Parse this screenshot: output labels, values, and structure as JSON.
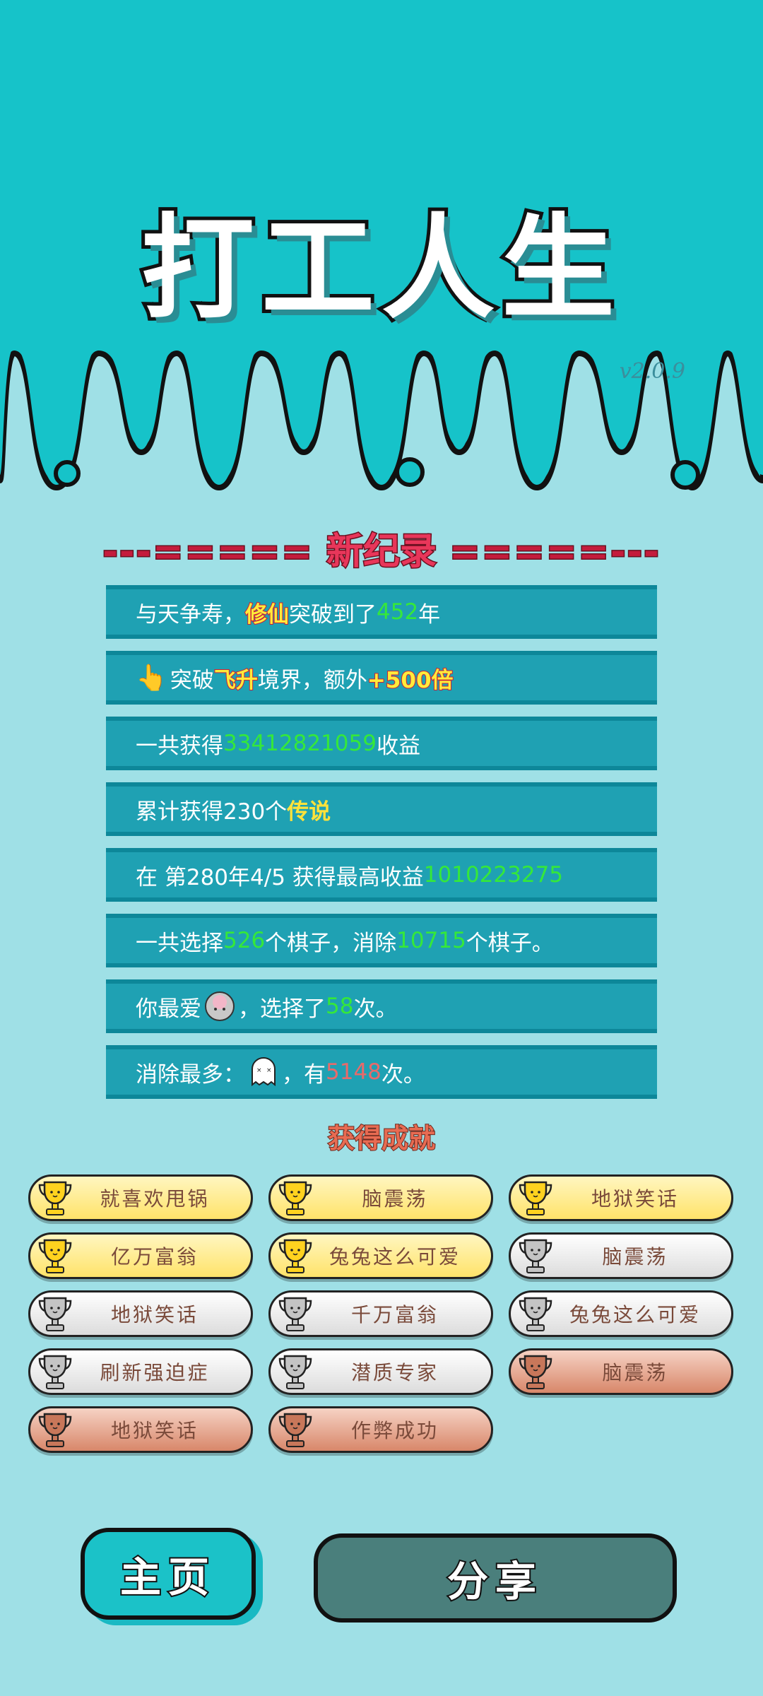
{
  "header": {
    "title": "打工人生",
    "version": "v2.0.9"
  },
  "record_section": {
    "dashes_left": "---=====",
    "title": "新纪录",
    "dashes_right": "=====---"
  },
  "records": [
    {
      "t1": "与天争寿，",
      "hl": "修仙",
      "t2": "突破到了",
      "num": "452",
      "t3": "年"
    },
    {
      "t1": "突破",
      "hl": "飞升",
      "t2": "境界，额外",
      "hl2": "+500倍"
    },
    {
      "t1": "一共获得",
      "num": "33412821059",
      "t2": "收益"
    },
    {
      "t1": "累计获得230个",
      "legend": "传说"
    },
    {
      "t1": "在 第280年4/5 获得最高收益",
      "num": "1010223275"
    },
    {
      "t1": "一共选择",
      "num": "526",
      "t2": "个棋子，消除",
      "num2": "10715",
      "t3": "个棋子。"
    },
    {
      "t1": "你最爱",
      "t2": "，选择了",
      "num": "58",
      "t3": "次。"
    },
    {
      "t1": "消除最多：",
      "t2": "，有",
      "num": "5148",
      "t3": "次。"
    }
  ],
  "achievements_title": "获得成就",
  "achievements": [
    {
      "label": "就喜欢甩锅",
      "tier": "gold"
    },
    {
      "label": "脑震荡",
      "tier": "gold"
    },
    {
      "label": "地狱笑话",
      "tier": "gold"
    },
    {
      "label": "亿万富翁",
      "tier": "gold"
    },
    {
      "label": "兔兔这么可爱",
      "tier": "gold"
    },
    {
      "label": "脑震荡",
      "tier": "silver"
    },
    {
      "label": "地狱笑话",
      "tier": "silver"
    },
    {
      "label": "千万富翁",
      "tier": "silver"
    },
    {
      "label": "兔兔这么可爱",
      "tier": "silver"
    },
    {
      "label": "刷新强迫症",
      "tier": "silver"
    },
    {
      "label": "潜质专家",
      "tier": "silver"
    },
    {
      "label": "脑震荡",
      "tier": "bronze"
    },
    {
      "label": "地狱笑话",
      "tier": "bronze"
    },
    {
      "label": "作弊成功",
      "tier": "bronze"
    }
  ],
  "buttons": {
    "home": "主页",
    "share": "分享"
  },
  "colors": {
    "header_bg": "#16c3c9",
    "body_bg": "#9fe0e6",
    "record_bar": "#1fa1b3",
    "accent_green": "#35e83a",
    "accent_red": "#e8365a"
  },
  "icons": {
    "hand": "pointing-hand-icon",
    "favorite_piece": "gray-ball-icon",
    "most_removed": "ghost-icon",
    "trophy": "trophy-icon"
  }
}
